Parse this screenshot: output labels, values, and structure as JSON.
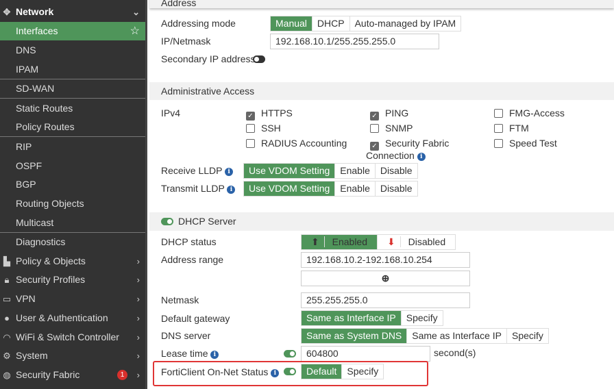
{
  "sidebar": {
    "network": "Network",
    "items": [
      "Interfaces",
      "DNS",
      "IPAM",
      "SD-WAN",
      "Static Routes",
      "Policy Routes",
      "RIP",
      "OSPF",
      "BGP",
      "Routing Objects",
      "Multicast",
      "Diagnostics"
    ],
    "menus": [
      "Policy & Objects",
      "Security Profiles",
      "VPN",
      "User & Authentication",
      "WiFi & Switch Controller",
      "System",
      "Security Fabric"
    ],
    "fabric_badge": "1"
  },
  "address": {
    "header": "Address",
    "mode_label": "Addressing mode",
    "modes": [
      "Manual",
      "DHCP",
      "Auto-managed by IPAM"
    ],
    "ip_label": "IP/Netmask",
    "ip_value": "192.168.10.1/255.255.255.0",
    "secondary_label": "Secondary IP address"
  },
  "admin": {
    "header": "Administrative Access",
    "ipv4_label": "IPv4",
    "checks": [
      {
        "label": "HTTPS",
        "checked": true
      },
      {
        "label": "PING",
        "checked": true
      },
      {
        "label": "FMG-Access",
        "checked": false
      },
      {
        "label": "SSH",
        "checked": false
      },
      {
        "label": "SNMP",
        "checked": false
      },
      {
        "label": "FTM",
        "checked": false
      },
      {
        "label": "RADIUS Accounting",
        "checked": false
      },
      {
        "label": "Security Fabric",
        "checked": true
      },
      {
        "label": "Speed Test",
        "checked": false
      }
    ],
    "fabric_cont": "Connection",
    "receive_label": "Receive LLDP",
    "transmit_label": "Transmit LLDP",
    "lldp_options": [
      "Use VDOM Setting",
      "Enable",
      "Disable"
    ]
  },
  "dhcp": {
    "header": "DHCP Server",
    "status_label": "DHCP status",
    "enabled": "Enabled",
    "disabled": "Disabled",
    "range_label": "Address range",
    "range_value": "192.168.10.2-192.168.10.254",
    "netmask_label": "Netmask",
    "netmask_value": "255.255.255.0",
    "gateway_label": "Default gateway",
    "gateway_options": [
      "Same as Interface IP",
      "Specify"
    ],
    "dns_label": "DNS server",
    "dns_options": [
      "Same as System DNS",
      "Same as Interface IP",
      "Specify"
    ],
    "lease_label": "Lease time",
    "lease_value": "604800",
    "lease_unit": "second(s)",
    "forticlient_label": "FortiClient On-Net Status",
    "forticlient_options": [
      "Default",
      "Specify"
    ]
  },
  "colors": {
    "accent": "#4f955a",
    "sidebar": "#333333",
    "highlight": "#e03535"
  }
}
